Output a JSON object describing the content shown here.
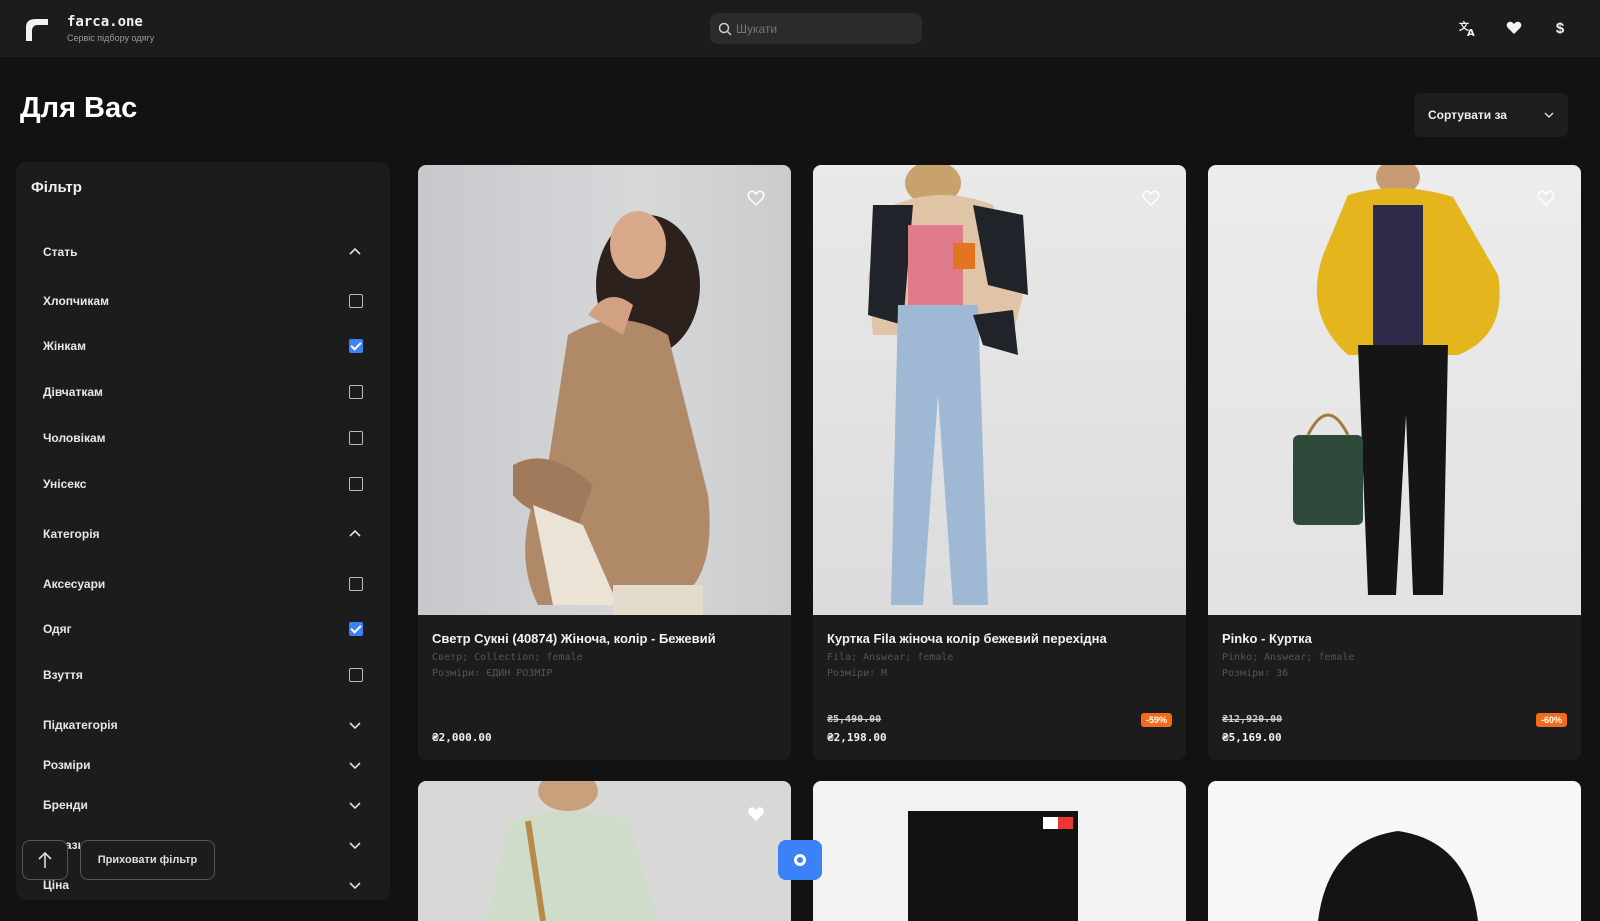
{
  "header": {
    "brand_name": "farca.one",
    "brand_sub": "Сервіс підбору одягу",
    "search_placeholder": "Шукати",
    "lang_icon": "translate-icon",
    "fav_icon": "heart-icon",
    "currency_symbol": "$"
  },
  "page": {
    "title": "Для Вас",
    "sort_label": "Сортувати за"
  },
  "filter": {
    "title": "Фільтр",
    "sections": [
      {
        "label": "Стать",
        "expanded": true
      },
      {
        "label": "Категорія",
        "expanded": true
      },
      {
        "label": "Підкатегорія",
        "expanded": false
      },
      {
        "label": "Розміри",
        "expanded": false
      },
      {
        "label": "Бренди",
        "expanded": false
      },
      {
        "label": "Магазини",
        "expanded": false
      },
      {
        "label": "Ціна",
        "expanded": false
      }
    ],
    "gender": [
      {
        "label": "Хлопчикам",
        "checked": false
      },
      {
        "label": "Жінкам",
        "checked": true
      },
      {
        "label": "Дівчаткам",
        "checked": false
      },
      {
        "label": "Чоловікам",
        "checked": false
      },
      {
        "label": "Унісекс",
        "checked": false
      }
    ],
    "category": [
      {
        "label": "Аксесуари",
        "checked": false
      },
      {
        "label": "Одяг",
        "checked": true
      },
      {
        "label": "Взуття",
        "checked": false
      }
    ],
    "hide_button": "Приховати фільтр"
  },
  "products": [
    {
      "title": "Светр Сукні (40874) Жіноча, колір - Бежевий",
      "meta1": "Светр; Collection; female",
      "meta2": "Розміри: ЄДИН РОЗМІР",
      "old_price": "",
      "price": "₴2,000.00",
      "discount": ""
    },
    {
      "title": "Куртка Fila жіноча колір бежевий перехідна",
      "meta1": "Fila; Answear; female",
      "meta2": "Розміри: M",
      "old_price": "₴5,490.00",
      "price": "₴2,198.00",
      "discount": "-59%"
    },
    {
      "title": "Pinko - Куртка",
      "meta1": "Pinko; Answear; female",
      "meta2": "Розміри: 36",
      "old_price": "₴12,920.00",
      "price": "₴5,169.00",
      "discount": "-60%"
    }
  ],
  "colors": {
    "accent": "#3b82f6",
    "discount": "#f26b1d",
    "background": "#121212",
    "panel": "#1c1c1c"
  }
}
